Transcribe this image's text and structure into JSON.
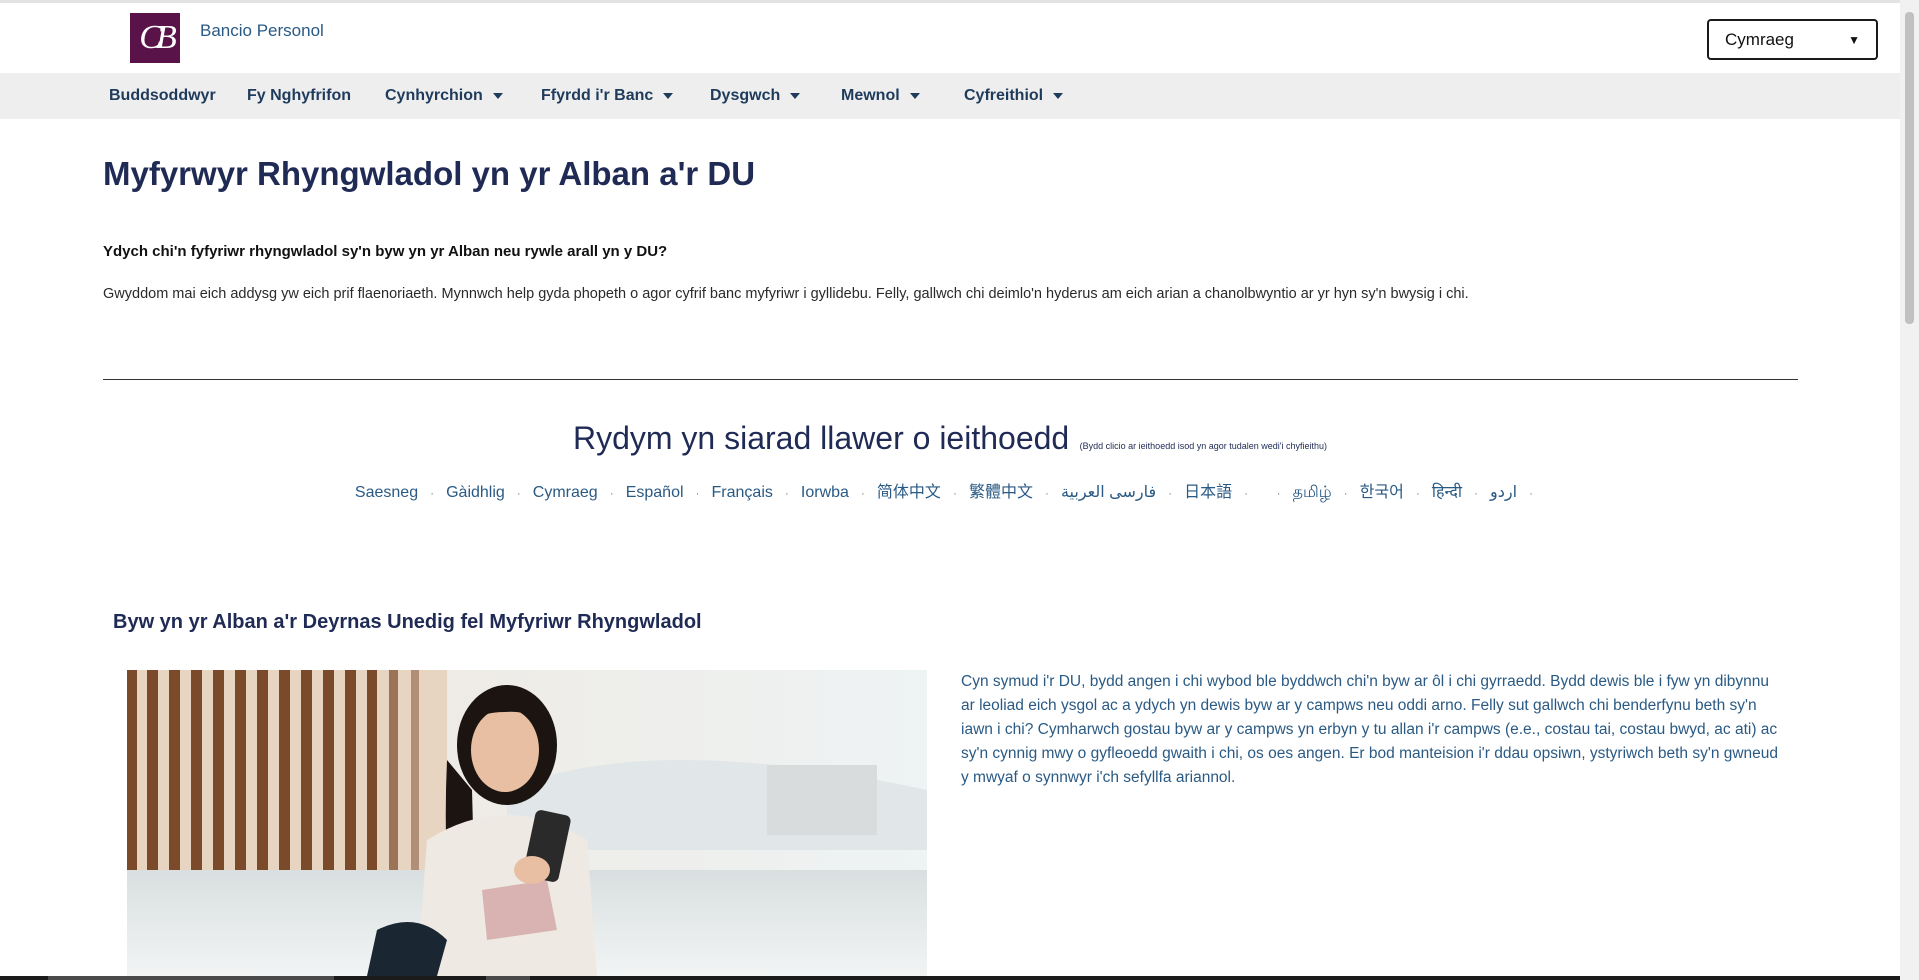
{
  "header": {
    "logo_text": "CB",
    "brand": "Bancio Personol",
    "language_select": {
      "selected": "Cymraeg"
    }
  },
  "nav": {
    "items": [
      {
        "label": "Buddsoddwyr",
        "has_dropdown": false
      },
      {
        "label": "Fy Nghyfrifon",
        "has_dropdown": false
      },
      {
        "label": "Cynhyrchion",
        "has_dropdown": true
      },
      {
        "label": "Ffyrdd i'r Banc",
        "has_dropdown": true
      },
      {
        "label": "Dysgwch",
        "has_dropdown": true
      },
      {
        "label": "Mewnol",
        "has_dropdown": true
      },
      {
        "label": "Cyfreithiol",
        "has_dropdown": true
      }
    ]
  },
  "main": {
    "title": "Myfyrwyr Rhyngwladol yn yr Alban a'r DU",
    "intro_question": "Ydych chi'n fyfyriwr rhyngwladol sy'n byw yn yr Alban neu rywle arall yn y DU?",
    "intro_paragraph": "Gwyddom mai eich addysg yw eich prif flaenoriaeth. Mynnwch help gyda phopeth o agor cyfrif banc myfyriwr i gyllidebu. Felly, gallwch chi deimlo'n hyderus am eich arian a chanolbwyntio ar yr hyn sy'n bwysig i chi."
  },
  "languages": {
    "heading": "Rydym yn siarad llawer o ieithoedd",
    "note": "(Bydd clicio ar ieithoedd isod yn agor tudalen wedi'i chyfieithu)",
    "separator": "·",
    "links": [
      "Saesneg",
      "Gàidhlig",
      "Cymraeg",
      "Español",
      "Français",
      "Iorwba",
      "简体中文",
      "繁體中文",
      "فارسی العربية",
      "日本語",
      " ",
      "தமிழ்",
      "한국어",
      "हिन्दी",
      "اردو"
    ]
  },
  "section": {
    "title": "Byw yn yr Alban a'r Deyrnas Unedig fel Myfyriwr Rhyngwladol",
    "body": "Cyn symud i'r DU, bydd angen i chi wybod ble byddwch chi'n byw ar ôl i chi gyrraedd. Bydd dewis ble i fyw yn dibynnu ar leoliad eich ysgol ac a ydych yn dewis byw ar y campws neu oddi arno. Felly sut gallwch chi benderfynu beth sy'n iawn i chi? Cymharwch gostau byw ar y campws yn erbyn y tu allan i'r campws (e.e., costau tai, costau bwyd, ac ati) ac sy'n cynnig mwy o gyfleoedd gwaith i chi, os oes angen. Er bod manteision i'r ddau opsiwn, ystyriwch beth sy'n gwneud y mwyaf o synnwyr i'ch sefyllfa ariannol."
  },
  "colors": {
    "brand_purple": "#5a1348",
    "heading_navy": "#1f2a55",
    "link_blue": "#2a5a84",
    "nav_bg": "#eeeeee"
  }
}
